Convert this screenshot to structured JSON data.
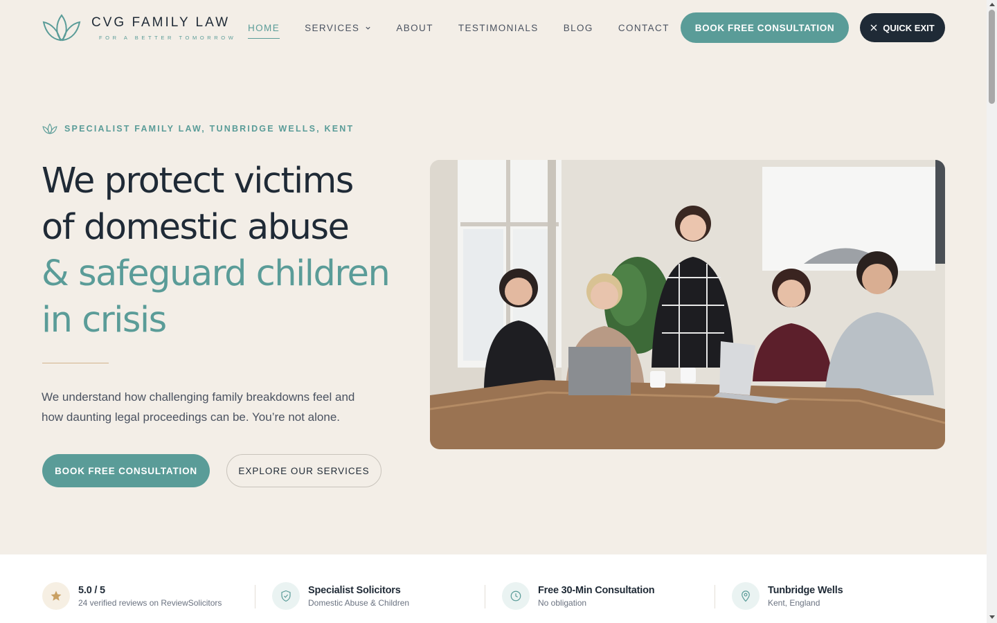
{
  "brand": {
    "name": "CVG FAMILY LAW",
    "tagline": "FOR A BETTER TOMORROW"
  },
  "nav": {
    "items": [
      {
        "label": "HOME",
        "active": true
      },
      {
        "label": "SERVICES"
      },
      {
        "label": "ABOUT"
      },
      {
        "label": "TESTIMONIALS"
      },
      {
        "label": "BLOG"
      },
      {
        "label": "CONTACT"
      }
    ],
    "book_label": "BOOK FREE CONSULTATION",
    "exit_label": "QUICK EXIT"
  },
  "hero": {
    "eyebrow": "SPECIALIST FAMILY LAW, TUNBRIDGE WELLS, KENT",
    "headline_line1": "We protect victims",
    "headline_line2": "of domestic abuse",
    "headline_line3": "& safeguard children",
    "headline_line4": "in crisis",
    "intro_line1": "We understand how challenging family breakdowns feel and",
    "intro_line2": "how daunting legal proceedings can be. You’re not alone.",
    "primary_cta": "BOOK FREE CONSULTATION",
    "secondary_cta": "EXPLORE OUR SERVICES"
  },
  "stats": [
    {
      "title": "5.0 / 5",
      "sub": "24 verified reviews on ReviewSolicitors",
      "icon": "star-icon"
    },
    {
      "title": "Specialist Solicitors",
      "sub": "Domestic Abuse & Children",
      "icon": "shield-check-icon"
    },
    {
      "title": "Free 30-Min Consultation",
      "sub": "No obligation",
      "icon": "clock-icon"
    },
    {
      "title": "Tunbridge Wells",
      "sub": "Kent, England",
      "icon": "map-pin-icon"
    }
  ],
  "colors": {
    "background": "#f3eee7",
    "accent": "#5a9c98",
    "dark": "#1f2a36",
    "gold": "#c9a063"
  }
}
